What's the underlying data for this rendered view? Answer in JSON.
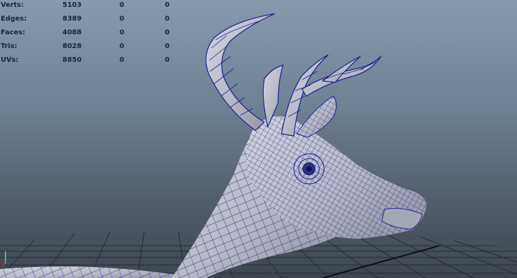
{
  "heads_up_display": {
    "rows": [
      {
        "label": "Verts:",
        "total": "5103",
        "selected": "0",
        "extra": "0"
      },
      {
        "label": "Edges:",
        "total": "8389",
        "selected": "0",
        "extra": "0"
      },
      {
        "label": "Faces:",
        "total": "4088",
        "selected": "0",
        "extra": "0"
      },
      {
        "label": "Tris:",
        "total": "8028",
        "selected": "0",
        "extra": "0"
      },
      {
        "label": "UVs:",
        "total": "8850",
        "selected": "0",
        "extra": "0"
      }
    ]
  },
  "viewport": {
    "model": "deer-head-wireframe",
    "wire_color": "#1b1f8f",
    "shade_color": "#bfc1cc",
    "background_top": "#8799ac",
    "background_bottom": "#3d4650",
    "grid_color": "#2a2f34",
    "axis_colors": {
      "x": "#e03020",
      "y": "#30d040",
      "z": "#3050e0"
    }
  }
}
